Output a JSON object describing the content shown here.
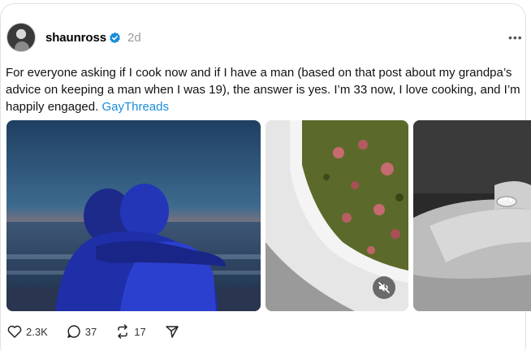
{
  "post": {
    "username": "shaunross",
    "time": "2d",
    "text_before_tag": "For everyone asking if I cook now and if I have a man (based on that post about my grandpa’s advice on keeping a man when I was 19), the answer is yes. I’m 33 now, I love cooking, and I’m happily engaged. ",
    "tag": "GayThreads",
    "verified_color": "#1a8cd8"
  },
  "media": [
    {
      "icon": "photo-couple-beach"
    },
    {
      "icon": "photo-food-dish",
      "mute_icon": "speaker-muted-icon"
    },
    {
      "icon": "photo-ring-hand"
    }
  ],
  "actions": {
    "likes": "2.3K",
    "replies": "37",
    "reposts": "17"
  }
}
